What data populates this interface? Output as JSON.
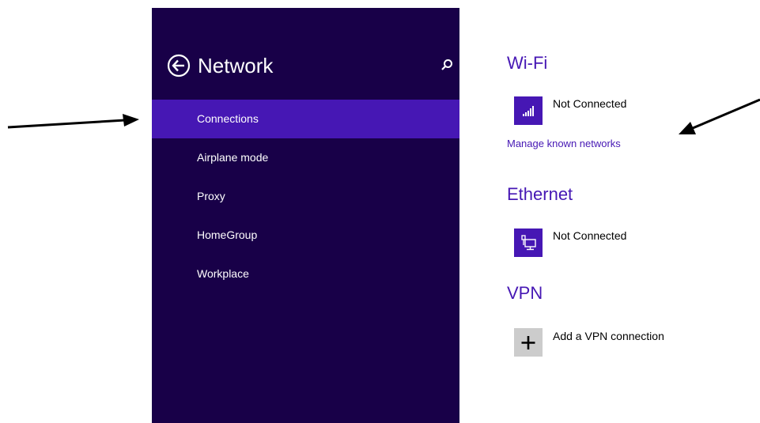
{
  "sidebar": {
    "title": "Network",
    "back_icon": "back-arrow-circle-icon",
    "search_icon": "search-icon",
    "items": [
      {
        "label": "Connections",
        "selected": true
      },
      {
        "label": "Airplane mode",
        "selected": false
      },
      {
        "label": "Proxy",
        "selected": false
      },
      {
        "label": "HomeGroup",
        "selected": false
      },
      {
        "label": "Workplace",
        "selected": false
      }
    ]
  },
  "wifi": {
    "title": "Wi-Fi",
    "status": "Not Connected",
    "icon": "wifi-signal-icon",
    "manage_link": "Manage known networks"
  },
  "ethernet": {
    "title": "Ethernet",
    "status": "Not Connected",
    "icon": "ethernet-icon"
  },
  "vpn": {
    "title": "VPN",
    "add_label": "Add a VPN connection",
    "icon": "plus-icon"
  },
  "colors": {
    "sidebar_bg": "#180048",
    "accent": "#4617b4",
    "tile_gray": "#cccccc"
  }
}
